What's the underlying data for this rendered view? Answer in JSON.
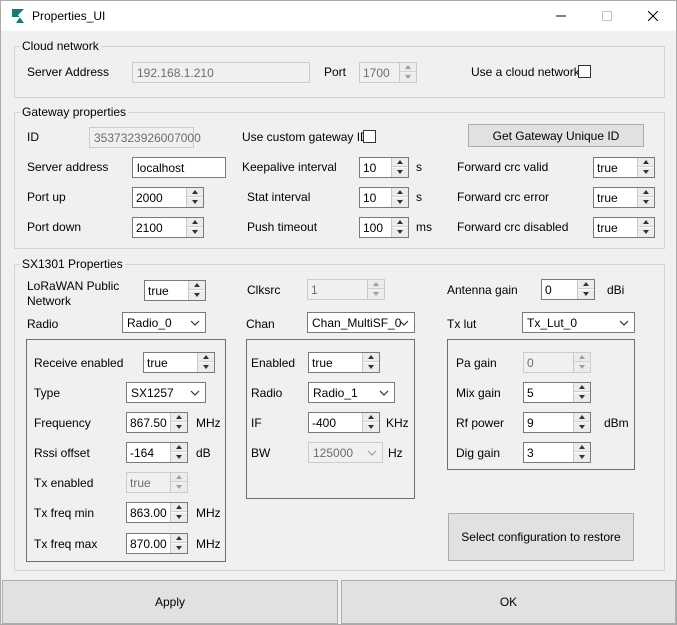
{
  "window": {
    "title": "Properties_UI"
  },
  "cloud": {
    "group_title": "Cloud network",
    "server_label": "Server Address",
    "server_value": "192.168.1.210",
    "port_label": "Port",
    "port_value": "1700",
    "use_cloud_label": "Use a cloud network"
  },
  "gateway": {
    "group_title": "Gateway properties",
    "id_label": "ID",
    "id_value": "3537323926007000",
    "custom_id_label": "Use custom gateway ID",
    "unique_id_button": "Get Gateway Unique ID",
    "server_label": "Server address",
    "server_value": "localhost",
    "port_up_label": "Port up",
    "port_up_value": "2000",
    "port_down_label": "Port down",
    "port_down_value": "2100",
    "keepalive_label": "Keepalive interval",
    "keepalive_value": "10",
    "keepalive_unit": "s",
    "stat_label": "Stat interval",
    "stat_value": "10",
    "stat_unit": "s",
    "push_label": "Push timeout",
    "push_value": "100",
    "push_unit": "ms",
    "crc_valid_label": "Forward crc valid",
    "crc_valid_value": "true",
    "crc_error_label": "Forward crc error",
    "crc_error_value": "true",
    "crc_disabled_label": "Forward crc disabled",
    "crc_disabled_value": "true"
  },
  "sx1301": {
    "group_title": "SX1301 Properties",
    "lorawan_label_1": "LoRaWAN Public",
    "lorawan_label_2": "Network",
    "lorawan_value": "true",
    "clksrc_label": "Clksrc",
    "clksrc_value": "1",
    "antenna_label": "Antenna gain",
    "antenna_value": "0",
    "antenna_unit": "dBi",
    "radio_label": "Radio",
    "radio_value": "Radio_0",
    "chan_label": "Chan",
    "chan_value": "Chan_MultiSF_0",
    "txlut_label": "Tx lut",
    "txlut_value": "Tx_Lut_0",
    "radio_frame": {
      "receive_label": "Receive enabled",
      "receive_value": "true",
      "type_label": "Type",
      "type_value": "SX1257",
      "freq_label": "Frequency",
      "freq_value": "867.50",
      "freq_unit": "MHz",
      "rssi_label": "Rssi offset",
      "rssi_value": "-164",
      "rssi_unit": "dB",
      "tx_enabled_label": "Tx enabled",
      "tx_enabled_value": "true",
      "txmin_label": "Tx freq min",
      "txmin_value": "863.00",
      "txmin_unit": "MHz",
      "txmax_label": "Tx freq max",
      "txmax_value": "870.00",
      "txmax_unit": "MHz"
    },
    "chan_frame": {
      "enabled_label": "Enabled",
      "enabled_value": "true",
      "radio_label": "Radio",
      "radio_value": "Radio_1",
      "if_label": "IF",
      "if_value": "-400",
      "if_unit": "KHz",
      "bw_label": "BW",
      "bw_value": "125000",
      "bw_unit": "Hz"
    },
    "txlut_frame": {
      "pa_label": "Pa gain",
      "pa_value": "0",
      "mix_label": "Mix gain",
      "mix_value": "5",
      "rf_label": "Rf power",
      "rf_value": "9",
      "rf_unit": "dBm",
      "dig_label": "Dig gain",
      "dig_value": "3"
    },
    "restore_button": "Select configuration to restore"
  },
  "footer": {
    "apply": "Apply",
    "ok": "OK"
  }
}
